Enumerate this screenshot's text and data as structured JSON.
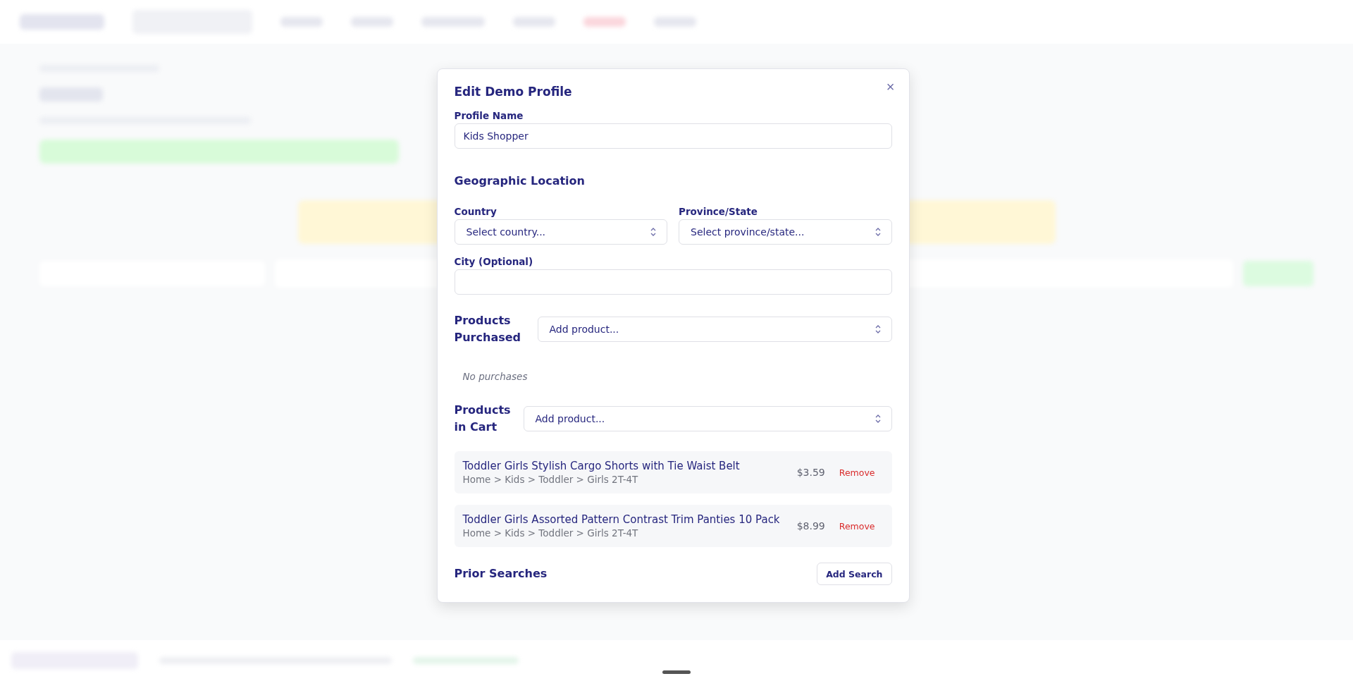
{
  "dialog": {
    "title": "Edit Demo Profile",
    "close": "×",
    "profile_name": {
      "label": "Profile Name",
      "value": "Kids Shopper"
    },
    "location": {
      "heading": "Geographic Location",
      "country": {
        "label": "Country",
        "placeholder": "Select country..."
      },
      "province": {
        "label": "Province/State",
        "placeholder": "Select province/state..."
      },
      "city": {
        "label": "City (Optional)"
      }
    },
    "purchased": {
      "label": "Products Purchased",
      "placeholder": "Add product...",
      "empty": "No purchases"
    },
    "cart": {
      "label": "Products in Cart",
      "placeholder": "Add product...",
      "items": [
        {
          "name": "Toddler Girls Stylish Cargo Shorts with Tie Waist Belt",
          "path": "Home > Kids > Toddler > Girls 2T-4T",
          "price": "$3.59",
          "action": "Remove"
        },
        {
          "name": "Toddler Girls Assorted Pattern Contrast Trim Panties 10 Pack",
          "path": "Home > Kids > Toddler > Girls 2T-4T",
          "price": "$8.99",
          "action": "Remove"
        }
      ]
    },
    "prior_searches": {
      "heading": "Prior Searches",
      "button": "Add Search"
    }
  }
}
